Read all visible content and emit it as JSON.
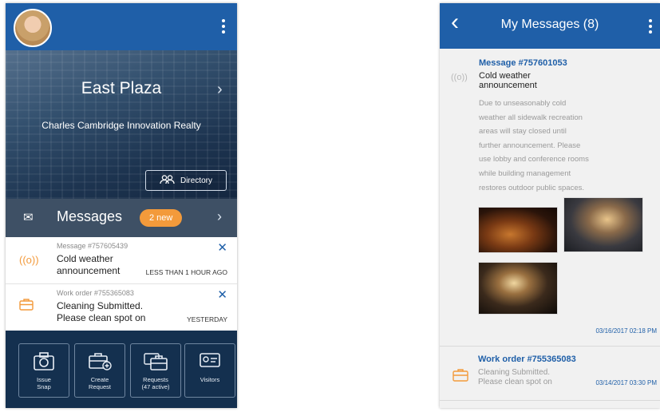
{
  "home": {
    "building_name": "East Plaza",
    "company": "Charles Cambridge Innovation Realty",
    "directory_label": "Directory",
    "messages_label": "Messages",
    "messages_badge": "2 new",
    "notifications": [
      {
        "id_label": "Message #757605439",
        "title_line1": "Cold weather",
        "title_line2": "announcement",
        "time": "LESS THAN 1 HOUR AGO"
      },
      {
        "id_label": "Work order #755365083",
        "title_line1": "Cleaning Submitted.",
        "title_line2": "Please clean spot on",
        "time": "YESTERDAY"
      }
    ],
    "tiles": [
      {
        "line1": "Issue",
        "line2": "Snap"
      },
      {
        "line1": "Create",
        "line2": "Request"
      },
      {
        "line1": "Requests",
        "line2": "(47 active)"
      },
      {
        "line1": "Visitors",
        "line2": ""
      }
    ]
  },
  "inbox": {
    "title": "My Messages (8)",
    "message": {
      "id_label": "Message #757601053",
      "title_line1": "Cold weather",
      "title_line2": "announcement",
      "body_lines": [
        "Due to unseasonably cold",
        "weather all sidewalk recreation",
        "areas will stay closed until",
        "further announcement. Please",
        "use lobby and conference rooms",
        "while building management",
        "restores outdoor public spaces."
      ],
      "date": "03/16/2017 02:18 PM"
    },
    "work_order": {
      "id_label": "Work order #755365083",
      "line1": "Cleaning Submitted.",
      "line2": "Please clean spot on",
      "date": "03/14/2017 03:30 PM"
    }
  },
  "colors": {
    "primary": "#1f5fa8",
    "accent": "#f39a3b"
  },
  "icons": [
    "avatar",
    "more-vert-icon",
    "chevron-right-icon",
    "people-icon",
    "envelope-icon",
    "broadcast-icon",
    "briefcase-icon",
    "close-icon",
    "camera-icon",
    "back-arrow-icon",
    "id-card-icon"
  ]
}
